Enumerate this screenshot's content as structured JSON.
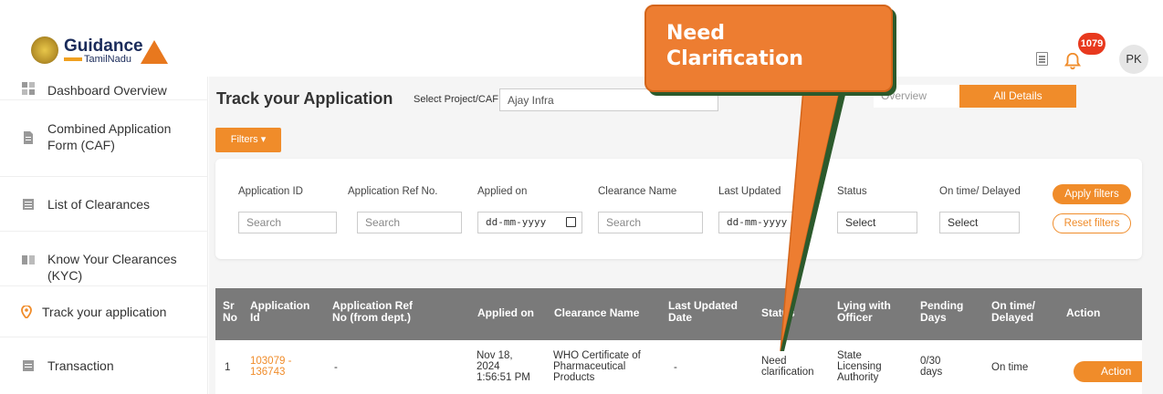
{
  "header": {
    "logo_text": "Guidance",
    "logo_sub": "TamilNadu",
    "notification_count": "1079",
    "avatar_initials": "PK"
  },
  "sidebar": {
    "items": [
      {
        "label": "Dashboard Overview",
        "icon": "dashboard-icon"
      },
      {
        "label": "Combined Application Form (CAF)",
        "icon": "document-icon"
      },
      {
        "label": "List of Clearances",
        "icon": "list-icon"
      },
      {
        "label": "Know Your Clearances (KYC)",
        "icon": "book-icon"
      },
      {
        "label": "Track your application",
        "icon": "location-pin-icon"
      },
      {
        "label": "Transaction",
        "icon": "transaction-icon"
      }
    ]
  },
  "main": {
    "title": "Track your Application",
    "project_label": "Select Project/CAF",
    "project_value": "Ajay Infra",
    "overview_tab": "Overview",
    "all_details_tab": "All Details",
    "filters_label": "Filters"
  },
  "filters": {
    "application_id_label": "Application ID",
    "application_id_placeholder": "Search",
    "ref_no_label": "Application Ref No.",
    "ref_no_placeholder": "Search",
    "applied_on_label": "Applied on",
    "applied_on_value": "dd-mm-yyyy",
    "clearance_name_label": "Clearance Name",
    "clearance_name_placeholder": "Search",
    "last_updated_label": "Last Updated",
    "last_updated_value": "dd-mm-yyyy",
    "status_label": "Status",
    "status_value": "Select",
    "ontime_label": "On time/ Delayed",
    "ontime_value": "Select",
    "apply_label": "Apply filters",
    "reset_label": "Reset filters"
  },
  "table": {
    "headers": {
      "sr_no": "Sr No",
      "sr_no_1": "Sr",
      "sr_no_2": "No",
      "app_id_1": "Application",
      "app_id_2": "Id",
      "ref_1": "Application Ref",
      "ref_2": "No (from dept.)",
      "applied_on": "Applied on",
      "clearance_name": "Clearance Name",
      "last_updated_1": "Last Updated",
      "last_updated_2": "Date",
      "status": "Status",
      "lying_1": "Lying with",
      "lying_2": "Officer",
      "pending_1": "Pending",
      "pending_2": "Days",
      "ontime_1": "On time/",
      "ontime_2": "Delayed",
      "action": "Action"
    },
    "row": {
      "sr": "1",
      "app_id_1": "103079 -",
      "app_id_2": "136743",
      "ref": "-",
      "applied_1": "Nov 18,",
      "applied_2": "2024",
      "applied_3": "1:56:51 PM",
      "clearance_1": "WHO Certificate of",
      "clearance_2": "Pharmaceutical",
      "clearance_3": "Products",
      "last_updated": "-",
      "status_1": "Need",
      "status_2": "clarification",
      "lying_1": "State",
      "lying_2": "Licensing",
      "lying_3": "Authority",
      "pending_1": "0/30",
      "pending_2": "days",
      "ontime": "On time",
      "action": "Action"
    }
  },
  "callout": {
    "line1": "Need",
    "line2": "Clarification",
    "color": "#ed7d31"
  }
}
